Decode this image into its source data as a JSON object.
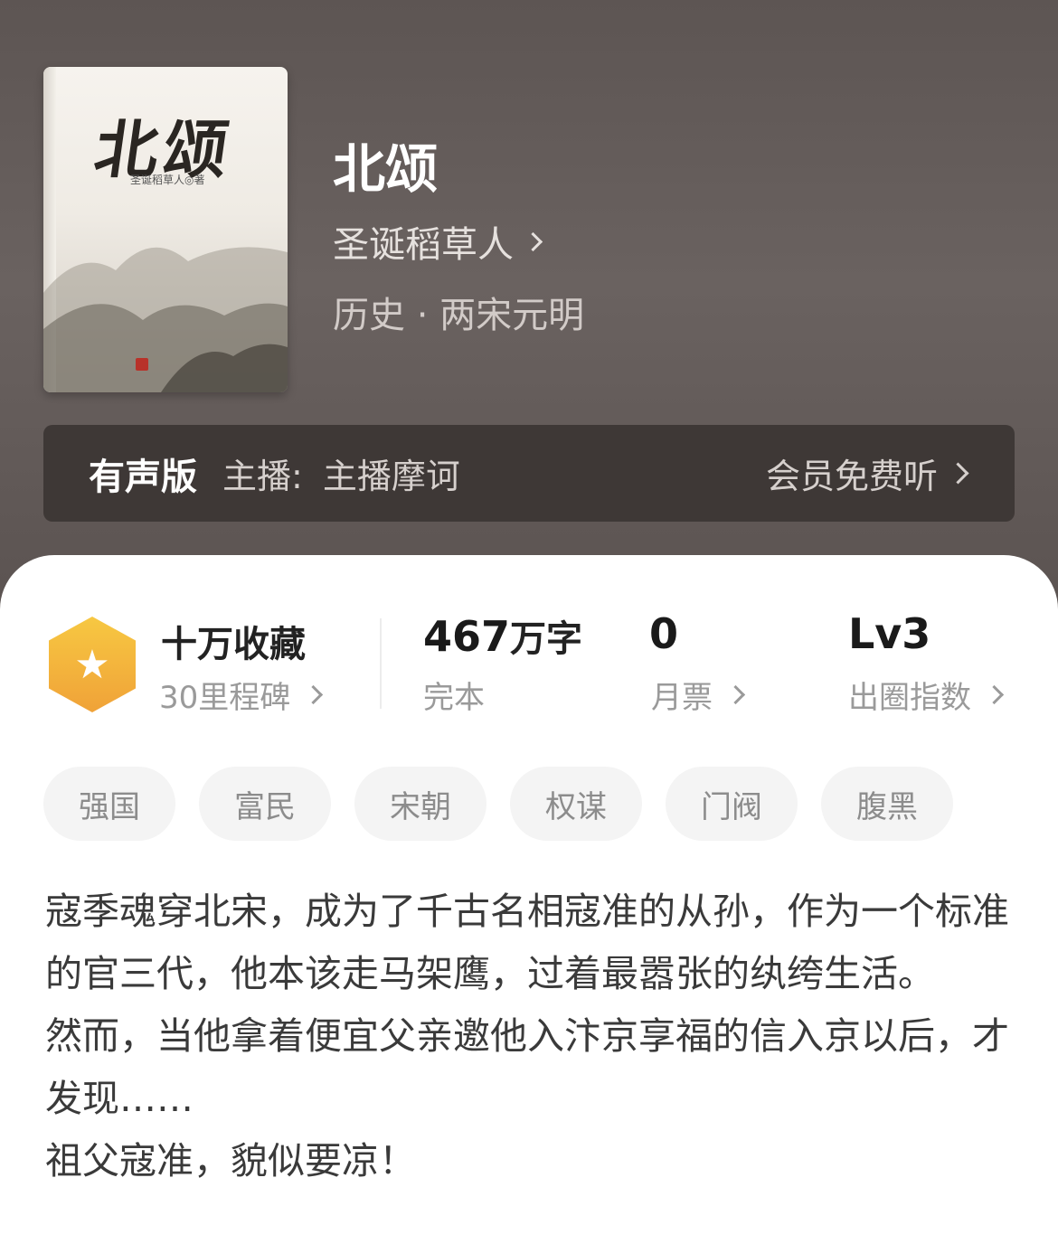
{
  "book": {
    "cover_title": "北颂",
    "cover_author": "圣诞稻草人◎著",
    "title": "北颂",
    "author": "圣诞稻草人",
    "genre": "历史 · 两宋元明"
  },
  "audio": {
    "label": "有声版",
    "host_prefix": "主播:",
    "host": "主播摩诃",
    "action": "会员免费听"
  },
  "stats": {
    "collection": {
      "main": "十万收藏",
      "sub": "30里程碑"
    },
    "words": {
      "number": "467",
      "unit": "万字",
      "sub": "完本"
    },
    "tickets": {
      "number": "0",
      "sub": "月票"
    },
    "index": {
      "number": "Lv3",
      "sub": "出圈指数"
    }
  },
  "tags": [
    "强国",
    "富民",
    "宋朝",
    "权谋",
    "门阀",
    "腹黑"
  ],
  "description": [
    "寇季魂穿北宋，成为了千古名相寇准的从孙，作为一个标准的官三代，他本该走马架鹰，过着最嚣张的纨绔生活。",
    "然而，当他拿着便宜父亲邀他入汴京享福的信入京以后，才发现……",
    "祖父寇准，貌似要凉！"
  ],
  "icons": {
    "collection_badge": "star-hexagon-icon",
    "chevron": "chevron-right-icon"
  },
  "colors": {
    "header_bg": "#625a58",
    "badge": "#f3b63d"
  }
}
